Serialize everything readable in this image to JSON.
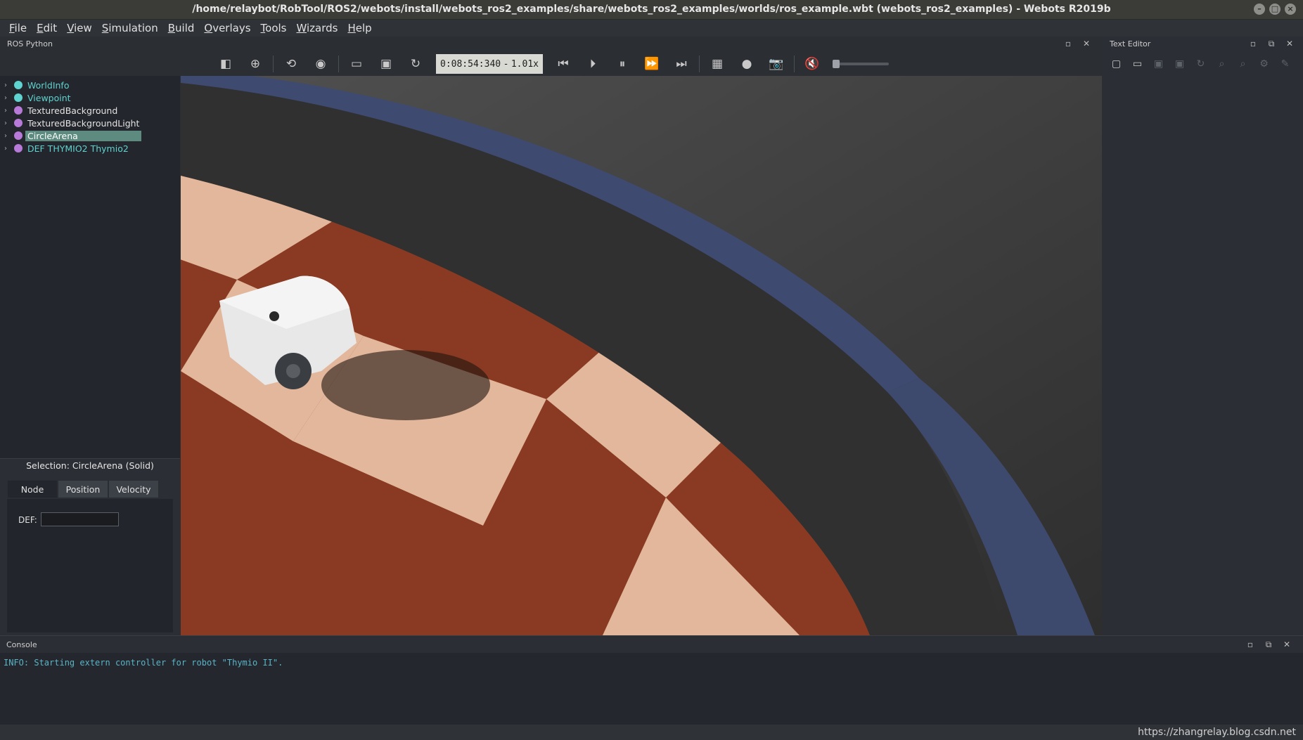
{
  "window": {
    "title": "/home/relaybot/RobTool/ROS2/webots/install/webots_ros2_examples/share/webots_ros2_examples/worlds/ros_example.wbt (webots_ros2_examples) - Webots R2019b",
    "controls": [
      "minimize",
      "maximize",
      "close"
    ]
  },
  "menubar": {
    "items": [
      {
        "accel": "F",
        "rest": "ile"
      },
      {
        "accel": "E",
        "rest": "dit"
      },
      {
        "accel": "V",
        "rest": "iew"
      },
      {
        "accel": "S",
        "rest": "imulation"
      },
      {
        "accel": "B",
        "rest": "uild"
      },
      {
        "accel": "O",
        "rest": "verlays"
      },
      {
        "accel": "T",
        "rest": "ools"
      },
      {
        "accel": "W",
        "rest": "izards"
      },
      {
        "accel": "H",
        "rest": "elp"
      }
    ]
  },
  "left_dock": {
    "title": "ROS Python"
  },
  "toolbar": {
    "time": "0:08:54:340",
    "separator_char": "-",
    "speed": "1.01x"
  },
  "scene_tree": {
    "items": [
      {
        "label": "WorldInfo",
        "dot_color": "#5fd3d0",
        "label_color": "#5fd3d0"
      },
      {
        "label": "Viewpoint",
        "dot_color": "#5fd3d0",
        "label_color": "#5fd3d0"
      },
      {
        "label": "TexturedBackground",
        "dot_color": "#b87ad8",
        "label_color": "#e2e2e2"
      },
      {
        "label": "TexturedBackgroundLight",
        "dot_color": "#b87ad8",
        "label_color": "#e2e2e2"
      },
      {
        "label": "CircleArena",
        "dot_color": "#b87ad8",
        "label_color": "#ffffff",
        "selected": true
      },
      {
        "label": "DEF THYMIO2 Thymio2",
        "dot_color": "#b87ad8",
        "label_color": "#5fd3d0"
      }
    ]
  },
  "selection": {
    "title": "Selection: CircleArena (Solid)",
    "tabs": [
      "Node",
      "Position",
      "Velocity"
    ],
    "def_label": "DEF:",
    "def_value": ""
  },
  "text_editor": {
    "title": "Text Editor"
  },
  "console": {
    "title": "Console",
    "lines": [
      "INFO: Starting extern controller for robot \"Thymio II\"."
    ]
  },
  "watermark": "https://zhangrelay.blog.csdn.net",
  "colors": {
    "accent_selected": "#5d8b7f",
    "console_text": "#5ab4c6",
    "floor_light": "#e2b79c",
    "floor_dark": "#8a3a22",
    "wall_blue": "#3f4a70"
  }
}
